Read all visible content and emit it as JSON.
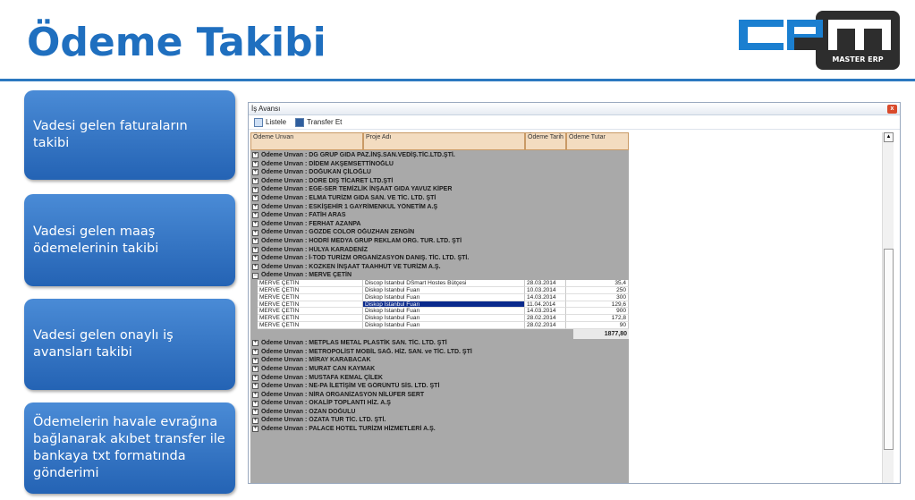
{
  "slide": {
    "title": "Ödeme Takibi",
    "logo_letters": "CPM",
    "logo_sub": "MASTER ERP"
  },
  "features": [
    "Vadesi gelen faturaların takibi",
    "Vadesi gelen maaş ödemelerinin takibi",
    "Vadesi gelen onaylı iş avansları takibi",
    "Ödemelerin havale evrağına bağlanarak akıbet transfer ile bankaya txt formatında gönderimi"
  ],
  "window": {
    "title": "İş Avansı",
    "close_label": "x",
    "toolbar": {
      "list_label": "Listele",
      "transfer_label": "Transfer Et"
    },
    "columns": [
      "Ödeme Unvan",
      "Proje Adı",
      "Ödeme Tarih",
      "Ödeme Tutar"
    ],
    "groups_before": [
      "Ödeme Unvan : DG GRUP GIDA PAZ.İNŞ.SAN.VEDİŞ.TİC.LTD.ŞTİ.",
      "Ödeme Unvan : DİDEM AKŞEMSETTİNOĞLU",
      "Ödeme Unvan : DOĞUKAN ÇİLOĞLU",
      "Ödeme Unvan : DORE DIŞ TİCARET LTD.ŞTİ",
      "Ödeme Unvan : EGE-SER TEMİZLİK İNŞAAT GIDA YAVUZ KİPER",
      "Ödeme Unvan : ELMA TURİZM GIDA SAN. VE TİC. LTD. ŞTİ",
      "Ödeme Unvan : ESKİŞEHİR 1 GAYRİMENKUL YÖNETİM A.Ş",
      "Ödeme Unvan : FATİH ARAS",
      "Ödeme Unvan : FERHAT AZANPA",
      "Ödeme Unvan : GÖZDE COLOR OĞUZHAN ZENGİN",
      "Ödeme Unvan : HODRİ MEDYA GRUP REKLAM ORG. TUR. LTD. ŞTİ",
      "Ödeme Unvan : HÜLYA KARADENİZ",
      "Ödeme Unvan : İ-TOD TURİZM ORGANİZASYON DANIŞ. TİC. LTD. ŞTİ.",
      "Ödeme Unvan : KOZKEN İNŞAAT TAAHHÜT VE TURİZM A.Ş."
    ],
    "expanded_group": "Ödeme Unvan : MERVE ÇETİN",
    "detail_rows": [
      [
        "MERVE ÇETİN",
        "Discop İstanbul DSmart Hostes Bütçesi",
        "28.03.2014",
        "35,4"
      ],
      [
        "MERVE ÇETİN",
        "Diskop İstanbul Fuarı",
        "10.03.2014",
        "250"
      ],
      [
        "MERVE ÇETİN",
        "Diskop İstanbul Fuarı",
        "14.03.2014",
        "300"
      ],
      [
        "MERVE ÇETİN",
        "Diskop İstanbul Fuarı",
        "11.04.2014",
        "129,6"
      ],
      [
        "MERVE ÇETİN",
        "Diskop İstanbul Fuarı",
        "14.03.2014",
        "900"
      ],
      [
        "MERVE ÇETİN",
        "Diskop İstanbul Fuarı",
        "28.02.2014",
        "172,8"
      ],
      [
        "MERVE ÇETİN",
        "Diskop İstanbul Fuarı",
        "28.02.2014",
        "90"
      ]
    ],
    "group_total": "1877,80",
    "groups_after": [
      "Ödeme Unvan : METPLAS METAL PLASTİK SAN. TİC. LTD. ŞTİ",
      "Ödeme Unvan : METROPOLİST MOBİL SAĞ. HİZ. SAN. ve TİC. LTD. ŞTİ",
      "Ödeme Unvan : MİRAY KARABACAK",
      "Ödeme Unvan : MURAT CAN KAYMAK",
      "Ödeme Unvan : MUSTAFA KEMAL ÇİLEK",
      "Ödeme Unvan : NE-PA İLETİŞİM VE GÖRÜNTÜ SİS. LTD. ŞTİ",
      "Ödeme Unvan : NİRA ORGANİZASYON NİLÜFER SERT",
      "Ödeme Unvan : OKALİP TOPLANTI HİZ. A.Ş",
      "Ödeme Unvan : OZAN DOĞULU",
      "Ödeme Unvan : ÖZATA TUR TİC. LTD. ŞTİ.",
      "Ödeme Unvan : PALACE HOTEL TURİZM HİZMETLERİ A.Ş."
    ],
    "selected_row_index": 3,
    "colors": {
      "accent": "#1f6fbf",
      "header_bg": "#f3dcc0",
      "group_bg": "#a9a9a9",
      "selection": "#0a2a8c"
    }
  }
}
